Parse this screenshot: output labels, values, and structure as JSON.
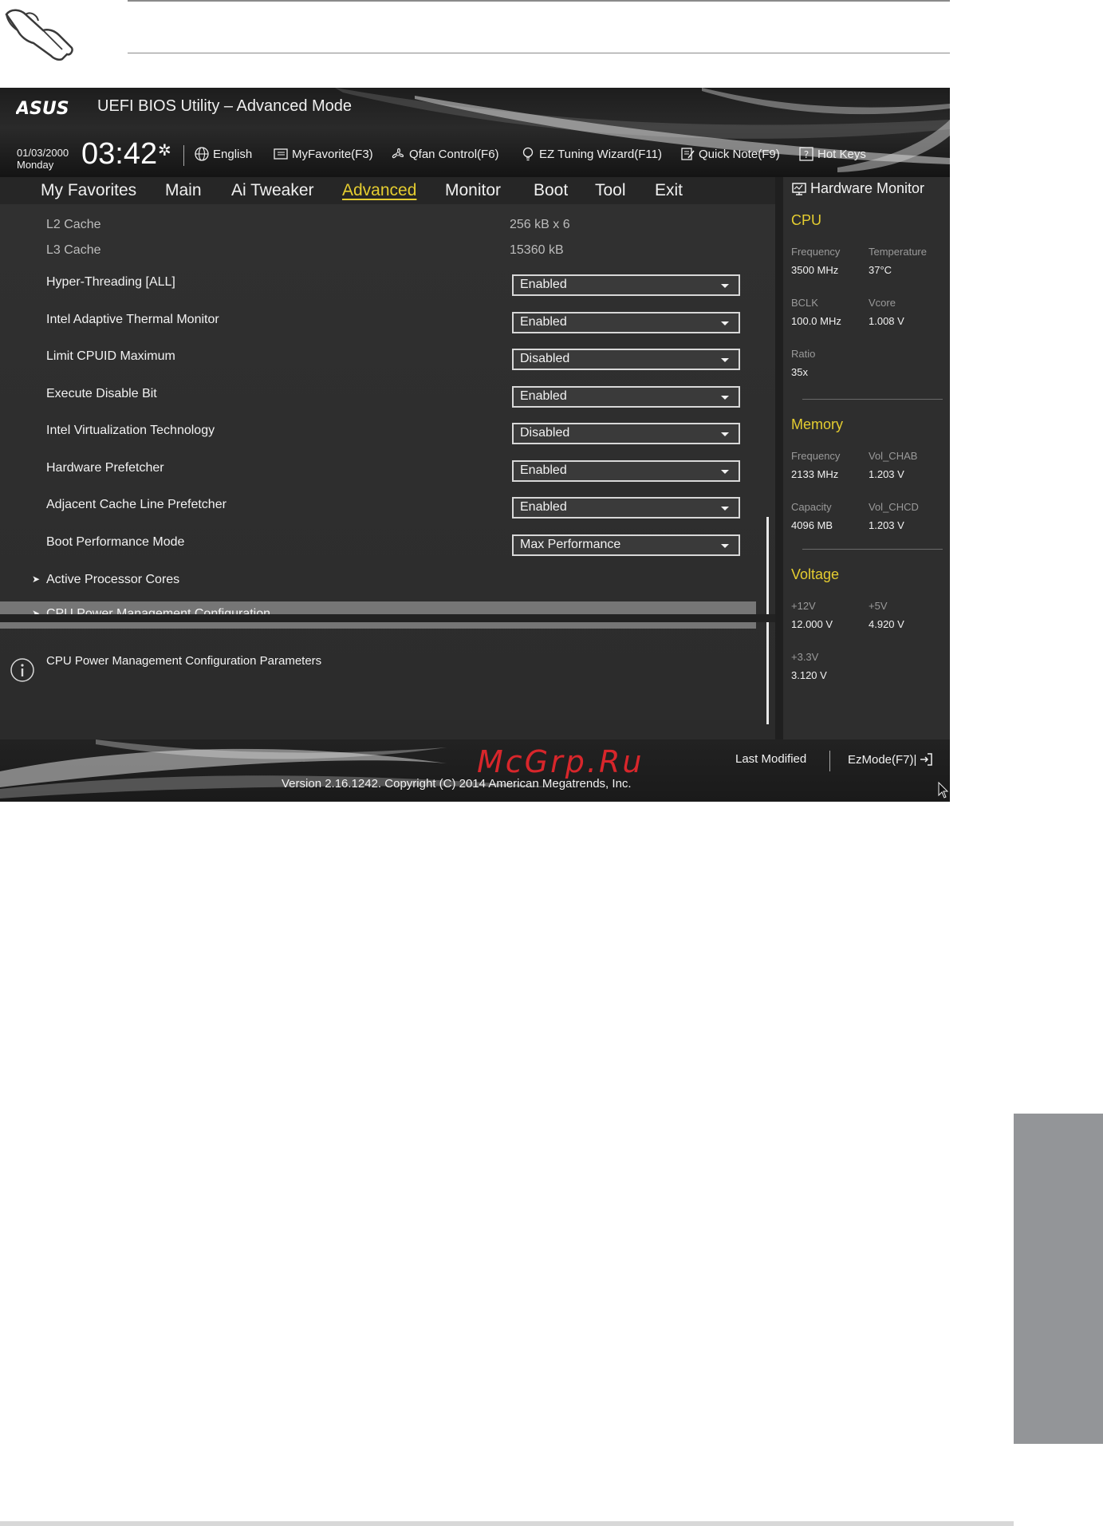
{
  "header": {
    "brand": "ASUS",
    "title": "UEFI BIOS Utility – Advanced Mode",
    "date": "01/03/2000",
    "day": "Monday",
    "time": "03:42",
    "toolbar": {
      "language": "English",
      "myfavorite": "MyFavorite(F3)",
      "qfan": "Qfan Control(F6)",
      "ez_tuning": "EZ Tuning Wizard(F11)",
      "quick_note": "Quick Note(F9)",
      "hot_keys": "Hot Keys"
    }
  },
  "tabs": [
    {
      "label": "My Favorites"
    },
    {
      "label": "Main"
    },
    {
      "label": "Ai Tweaker"
    },
    {
      "label": "Advanced",
      "active": true
    },
    {
      "label": "Monitor"
    },
    {
      "label": "Boot"
    },
    {
      "label": "Tool"
    },
    {
      "label": "Exit"
    }
  ],
  "settings": {
    "info_rows": [
      {
        "label": "L2 Cache",
        "value": "256 kB x 6"
      },
      {
        "label": "L3 Cache",
        "value": "15360 kB"
      }
    ],
    "option_rows": [
      {
        "label": "Hyper-Threading [ALL]",
        "value": "Enabled"
      },
      {
        "label": "Intel Adaptive Thermal Monitor",
        "value": "Enabled"
      },
      {
        "label": "Limit CPUID Maximum",
        "value": "Disabled"
      },
      {
        "label": "Execute Disable Bit",
        "value": "Enabled"
      },
      {
        "label": "Intel Virtualization Technology",
        "value": "Disabled"
      },
      {
        "label": "Hardware Prefetcher",
        "value": "Enabled"
      },
      {
        "label": "Adjacent Cache Line Prefetcher",
        "value": "Enabled"
      },
      {
        "label": "Boot Performance Mode",
        "value": "Max Performance"
      }
    ],
    "submenus": [
      {
        "label": "Active Processor Cores"
      },
      {
        "label": "CPU Power Management Configuration",
        "selected": true
      }
    ]
  },
  "help": {
    "text": "CPU Power Management Configuration Parameters"
  },
  "hardware_monitor": {
    "title": "Hardware Monitor",
    "cpu": {
      "heading": "CPU",
      "frequency_label": "Frequency",
      "frequency": "3500 MHz",
      "temperature_label": "Temperature",
      "temperature": "37°C",
      "bclk_label": "BCLK",
      "bclk": "100.0 MHz",
      "vcore_label": "Vcore",
      "vcore": "1.008 V",
      "ratio_label": "Ratio",
      "ratio": "35x"
    },
    "memory": {
      "heading": "Memory",
      "frequency_label": "Frequency",
      "frequency": "2133 MHz",
      "vol_chab_label": "Vol_CHAB",
      "vol_chab": "1.203 V",
      "capacity_label": "Capacity",
      "capacity": "4096 MB",
      "vol_chcd_label": "Vol_CHCD",
      "vol_chcd": "1.203 V"
    },
    "voltage": {
      "heading": "Voltage",
      "v12_label": "+12V",
      "v12": "12.000 V",
      "v5_label": "+5V",
      "v5": "4.920 V",
      "v33_label": "+3.3V",
      "v33": "3.120 V"
    }
  },
  "footer": {
    "watermark": "McGrp.Ru",
    "version": "Version 2.16.1242. Copyright (C) 2014 American Megatrends, Inc.",
    "last_modified": "Last Modified",
    "ezmode": "EzMode(F7)|"
  },
  "colors": {
    "accent": "#e5cd30",
    "selected_row": "#767676",
    "watermark": "#d8262b",
    "side_tab": "#939598"
  }
}
